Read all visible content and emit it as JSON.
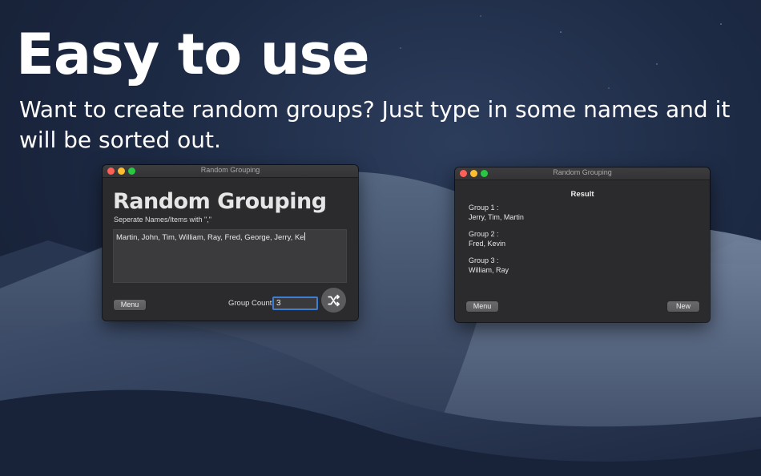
{
  "hero": {
    "headline": "Easy to use",
    "subline": "Want to create random groups? Just type in some names and it will be sorted out."
  },
  "left_window": {
    "window_title": "Random Grouping",
    "app_title": "Random Grouping",
    "instruction": "Seperate Names/Items with \",\"",
    "names_value": "Martin, John, Tim, William, Ray, Fred, George, Jerry, Ke",
    "menu_label": "Menu",
    "group_count_label": "Group Count",
    "group_count_value": "3",
    "shuffle_icon": "shuffle-icon"
  },
  "right_window": {
    "window_title": "Random Grouping",
    "result_title": "Result",
    "groups": [
      {
        "label": "Group 1 :",
        "members": "Jerry, Tim, Martin"
      },
      {
        "label": "Group 2 :",
        "members": "Fred, Kevin"
      },
      {
        "label": "Group 3 :",
        "members": "William, Ray"
      }
    ],
    "menu_label": "Menu",
    "new_label": "New"
  },
  "colors": {
    "accent": "#3f7fd2",
    "close": "#fe5f57",
    "minimize": "#febc2e",
    "maximize": "#28c840"
  }
}
